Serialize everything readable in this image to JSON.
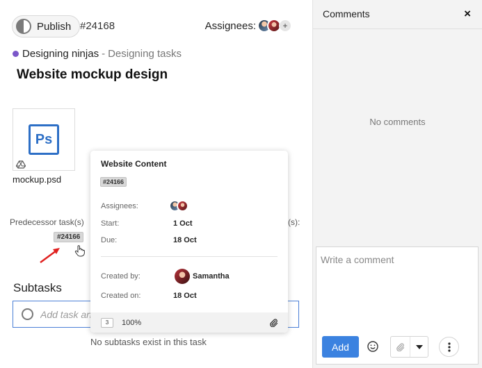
{
  "task": {
    "publish_label": "Publish",
    "id": "#24168",
    "assignees_label": "Assignees:",
    "add_assignee": "+",
    "project_name": "Designing ninjas",
    "project_separator": "-",
    "task_list": "Designing tasks",
    "title": "Website mockup design",
    "project_color": "#7b57c9"
  },
  "attachment": {
    "file_name": "mockup.psd",
    "icon_text": "Ps",
    "icon": "photoshop-file-icon"
  },
  "dependencies": {
    "predecessor_label": "Predecessor task(s)",
    "successor_label_tail": "(s):",
    "predecessor_id": "#24166"
  },
  "subtasks": {
    "title": "Subtasks",
    "input_placeholder": "Add task and hit enter",
    "empty_message": "No subtasks exist in this task"
  },
  "hover_card": {
    "title": "Website Content",
    "id": "#24166",
    "assignees_label": "Assignees:",
    "start_label": "Start:",
    "start_value": "1 Oct",
    "due_label": "Due:",
    "due_value": "18 Oct",
    "created_by_label": "Created by:",
    "created_by_value": "Samantha",
    "created_on_label": "Created on:",
    "created_on_value": "18 Oct",
    "count": "3",
    "progress": "100%"
  },
  "comments": {
    "title": "Comments",
    "close": "×",
    "empty_message": "No comments",
    "placeholder": "Write a comment",
    "add_label": "Add",
    "accent": "#3b82e0"
  }
}
